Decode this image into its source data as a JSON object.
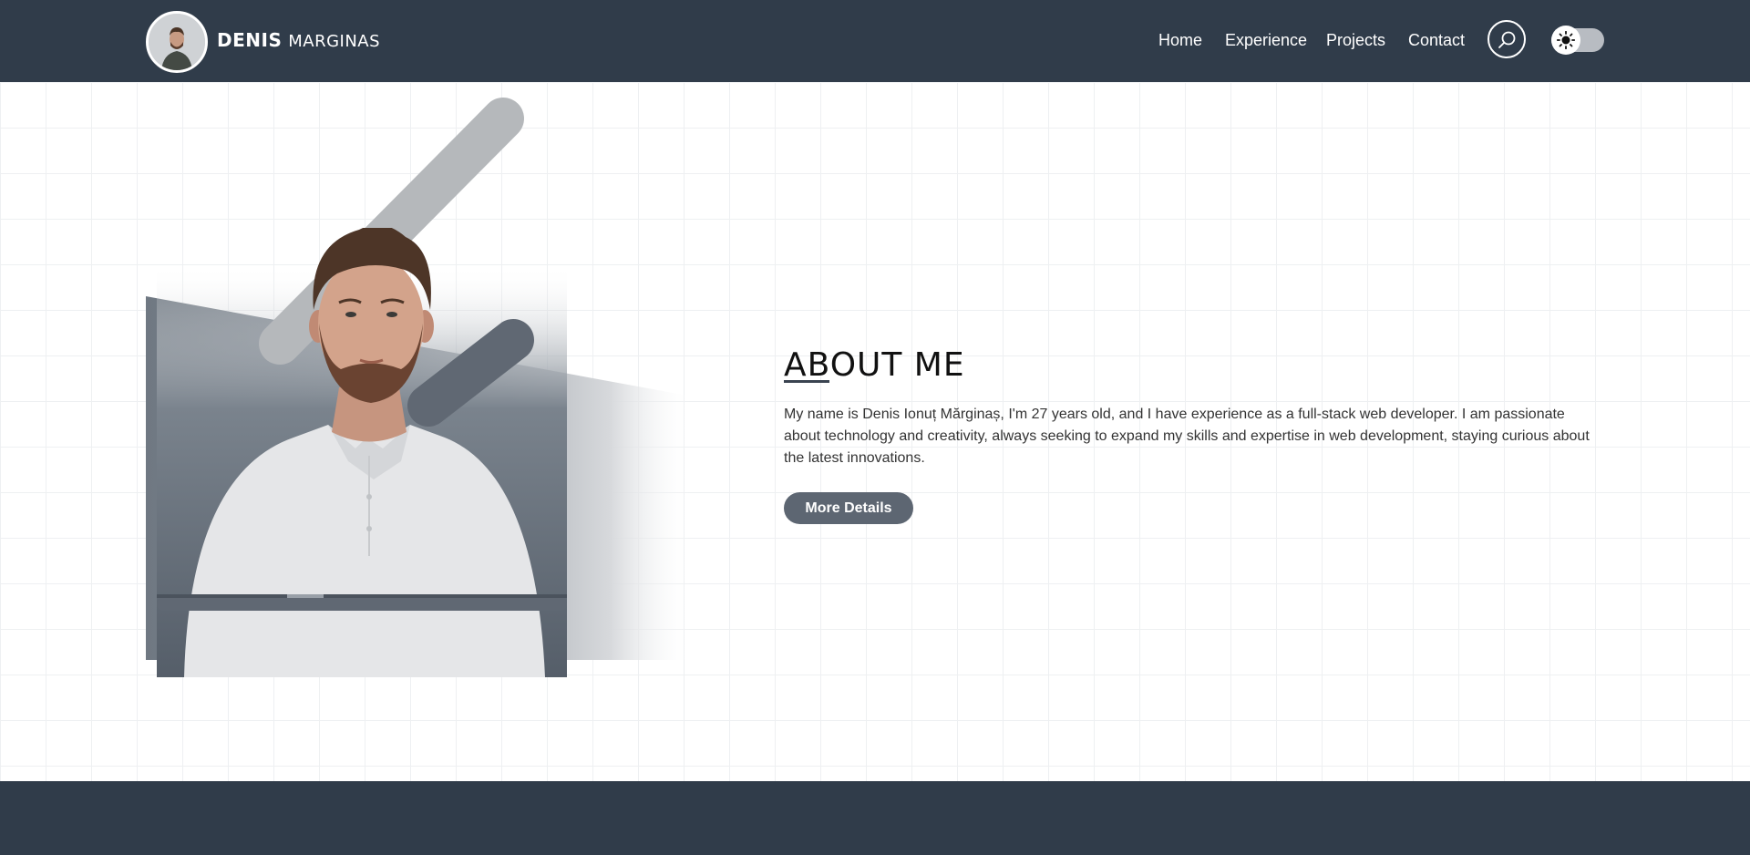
{
  "header": {
    "logo_first": "DENIS",
    "logo_last": "MARGINAS",
    "nav": [
      "Home",
      "Experience",
      "Projects",
      "Contact"
    ],
    "search_icon": "search-icon",
    "theme_toggle_icon": "sun-icon",
    "background": "#303c4a"
  },
  "about": {
    "title": "ABOUT ME",
    "text": "My name is Denis Ionuț Mărginaș, I'm 27 years old, and I have experience as a full-stack web developer. I am passionate about technology and creativity, always seeking to expand my skills and expertise in web development, staying curious about the latest innovations.",
    "button_label": "More Details",
    "portrait_icon": "profile-photo"
  },
  "colors": {
    "accent": "#5d6672",
    "dark": "#303c4a"
  }
}
